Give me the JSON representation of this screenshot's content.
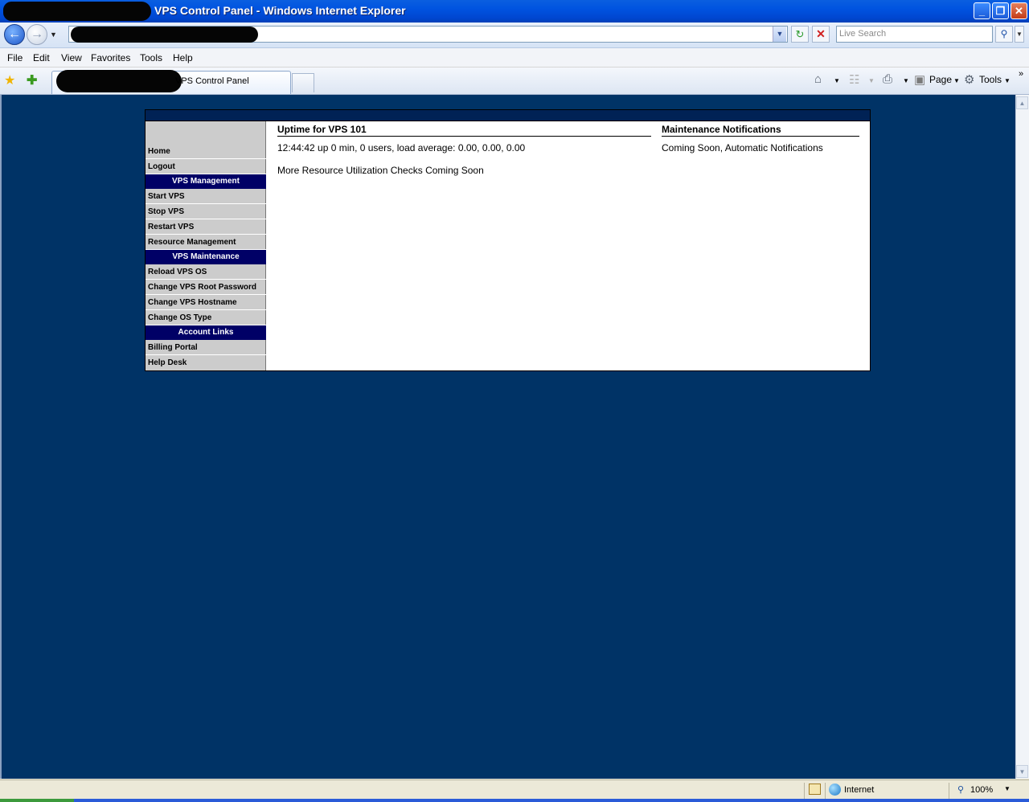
{
  "window": {
    "title": "VPS Control Panel - Windows Internet Explorer",
    "buttons": {
      "minimize": "_",
      "restore": "❐",
      "close": "✕"
    }
  },
  "addressbar": {
    "search_placeholder": "Live Search",
    "icons": [
      "back-arrow",
      "forward-arrow",
      "refresh",
      "stop",
      "search"
    ]
  },
  "menubar": {
    "items": [
      "File",
      "Edit",
      "View",
      "Favorites",
      "Tools",
      "Help"
    ]
  },
  "tabs": {
    "active_label": "VPS Control Panel"
  },
  "commandbar": {
    "page_label": "Page",
    "tools_label": "Tools"
  },
  "sidebar": {
    "home": "Home",
    "logout": "Logout",
    "sections": [
      {
        "title": "VPS Management",
        "items": [
          "Start VPS",
          "Stop VPS",
          "Restart VPS",
          "Resource Management"
        ]
      },
      {
        "title": "VPS Maintenance",
        "items": [
          "Reload VPS OS",
          "Change VPS Root Password",
          "Change VPS Hostname",
          "Change OS Type"
        ]
      },
      {
        "title": "Account Links",
        "items": [
          "Billing Portal",
          "Help Desk"
        ]
      }
    ]
  },
  "main": {
    "uptime_heading": "Uptime for VPS 101",
    "uptime_text": "12:44:42 up 0 min, 0 users, load average: 0.00, 0.00, 0.00",
    "resource_note": "More Resource Utilization Checks Coming Soon",
    "maint_heading": "Maintenance Notifications",
    "maint_text": "Coming Soon, Automatic Notifications"
  },
  "statusbar": {
    "zone": "Internet",
    "zoom": "100%"
  },
  "colors": {
    "page_background": "#003366",
    "sidebar_header": "#000066",
    "sidebar_item": "#cccccc"
  }
}
